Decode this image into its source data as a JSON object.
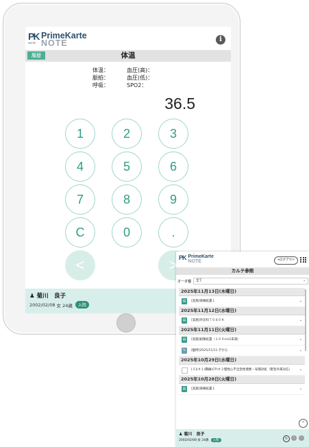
{
  "colors": {
    "accent": "#4caf94",
    "keypad_border": "#9ed6c8",
    "patient_bar": "#d8eeea",
    "badge": "#2e8f7a"
  },
  "app": {
    "brand_line1": "PrimeKarte",
    "brand_line2": "NOTE",
    "logo_letters": "PK",
    "logo_sub": "NOTE"
  },
  "tablet": {
    "history_button": "履歴",
    "page_title": "体温",
    "info_icon": "i",
    "vitals": {
      "labels": [
        [
          "体温：",
          "血圧(高)："
        ],
        [
          "脈拍：",
          "血圧(低)："
        ],
        [
          "呼吸：",
          "SPO2："
        ]
      ]
    },
    "display_value": "36.5",
    "keys": [
      "1",
      "2",
      "3",
      "4",
      "5",
      "6",
      "7",
      "8",
      "9",
      "C",
      "0",
      ".",
      "<",
      ">"
    ],
    "patient": {
      "name": "菊川　良子",
      "dob": "2002/02/08",
      "sex": "女",
      "age": "24歳",
      "status": "入院"
    }
  },
  "phone": {
    "logout_label": "ログアウト",
    "title": "カルテ参照",
    "filter_label": "オーダ種",
    "filter_value": "全て",
    "groups": [
      {
        "date": "2025年11月13日(木曜日)",
        "entries": [
          {
            "icon": "doc",
            "text": "[実施]病棟処置１"
          }
        ]
      },
      {
        "date": "2025年11月12日(水曜日)",
        "entries": [
          {
            "icon": "doc",
            "text": "[実施]外診料７０８０Ｋ"
          }
        ]
      },
      {
        "date": "2025年11月11日(火曜日)",
        "entries": [
          {
            "icon": "doc",
            "text": "[実施]創傷処置（１００cm2未満）"
          },
          {
            "icon": "alt",
            "text": "[臨時]2025/11/11 夕から"
          }
        ]
      },
      {
        "date": "2025年10月29日(水曜日)",
        "entries": [
          {
            "icon": "img",
            "text": "[Ｓ](＃１)胸痛(CP)＃２慢性心不全急性増悪・早期対処（緊急外来対応）"
          }
        ]
      },
      {
        "date": "2025年10月28日(火曜日)",
        "entries": [
          {
            "icon": "doc",
            "text": "[実施]病棟処置１"
          }
        ]
      }
    ],
    "patient": {
      "name": "菊川　良子",
      "dob": "2002/02/08",
      "sex": "女",
      "age": "24歳",
      "status": "入院"
    }
  }
}
